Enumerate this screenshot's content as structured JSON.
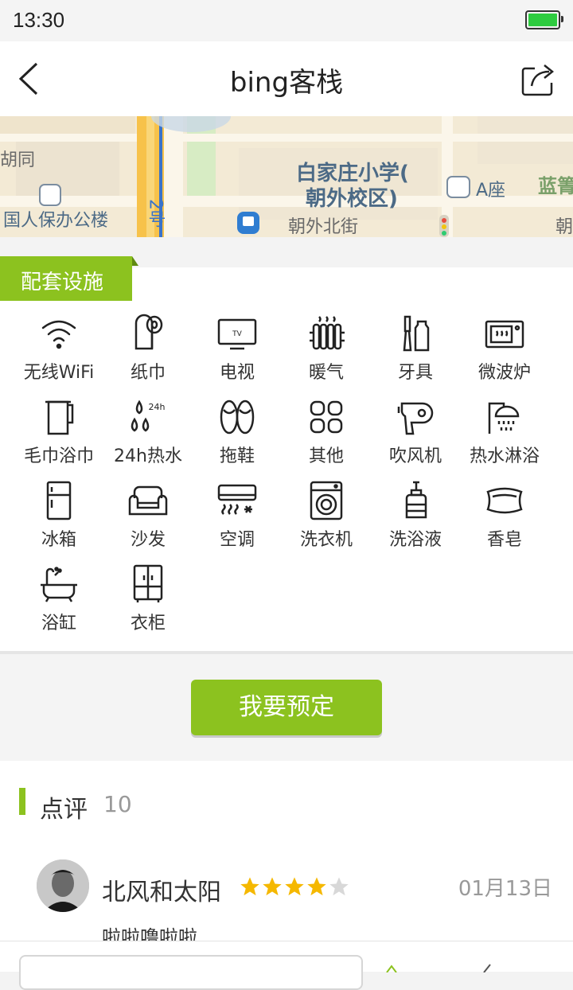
{
  "status_bar": {
    "time": "13:30"
  },
  "nav": {
    "title": "bing客栈"
  },
  "map": {
    "labels": {
      "school": "白家庄小学(",
      "school2": "朝外校区)",
      "a_building": "A座",
      "blue": "蓝箐",
      "left_top": "胡同",
      "left_bottom": "国人保办公楼",
      "street": "朝外北街",
      "right_edge": "朝",
      "road": "2号"
    }
  },
  "facilities": {
    "section_title": "配套设施",
    "items": [
      {
        "label": "无线WiFi",
        "icon": "wifi-icon"
      },
      {
        "label": "纸巾",
        "icon": "tissue-icon"
      },
      {
        "label": "电视",
        "icon": "tv-icon"
      },
      {
        "label": "暖气",
        "icon": "heater-icon"
      },
      {
        "label": "牙具",
        "icon": "toothbrush-icon"
      },
      {
        "label": "微波炉",
        "icon": "microwave-icon"
      },
      {
        "label": "毛巾浴巾",
        "icon": "towel-icon"
      },
      {
        "label": "24h热水",
        "icon": "hot-water-icon"
      },
      {
        "label": "拖鞋",
        "icon": "slippers-icon"
      },
      {
        "label": "其他",
        "icon": "other-icon"
      },
      {
        "label": "吹风机",
        "icon": "hair-dryer-icon"
      },
      {
        "label": "热水淋浴",
        "icon": "shower-icon"
      },
      {
        "label": "冰箱",
        "icon": "fridge-icon"
      },
      {
        "label": "沙发",
        "icon": "sofa-icon"
      },
      {
        "label": "空调",
        "icon": "air-conditioner-icon"
      },
      {
        "label": "洗衣机",
        "icon": "washing-machine-icon"
      },
      {
        "label": "洗浴液",
        "icon": "body-wash-icon"
      },
      {
        "label": "香皂",
        "icon": "soap-icon"
      },
      {
        "label": "浴缸",
        "icon": "bathtub-icon"
      },
      {
        "label": "衣柜",
        "icon": "wardrobe-icon"
      }
    ],
    "tv_text": "TV",
    "hot_water_text": "24h"
  },
  "booking": {
    "button_label": "我要预定"
  },
  "reviews": {
    "title": "点评",
    "count": "10",
    "items": [
      {
        "name": "北风和太阳",
        "rating": 4,
        "max_rating": 5,
        "date": "01月13日",
        "text": "啦啦噜啦啦"
      }
    ]
  },
  "colors": {
    "accent": "#8cc21f",
    "star_filled": "#f5b800",
    "star_empty": "#d8d8d8"
  }
}
